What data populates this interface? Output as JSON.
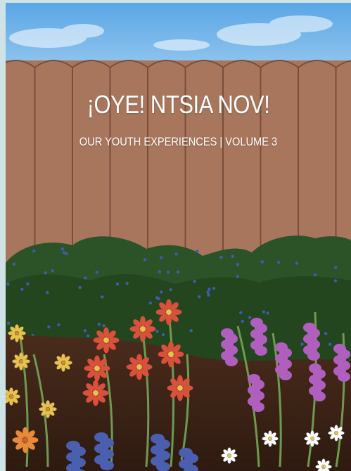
{
  "cover": {
    "title": "¡OYE! NTSIA NOV!",
    "subtitle": "OUR YOUTH EXPERIENCES | VOLUME 3"
  },
  "colors": {
    "sky": "#6eb3e8",
    "fence": "#a8765c",
    "fence_line": "#7a4e3b",
    "bush": "#2f5a2a",
    "soil": "#3b2217",
    "red_flower": "#d9503c",
    "yellow_flower": "#e8c24f",
    "lavender": "#b05fbf",
    "blue_flower": "#4b5fb0",
    "white_flower": "#ffffff"
  }
}
